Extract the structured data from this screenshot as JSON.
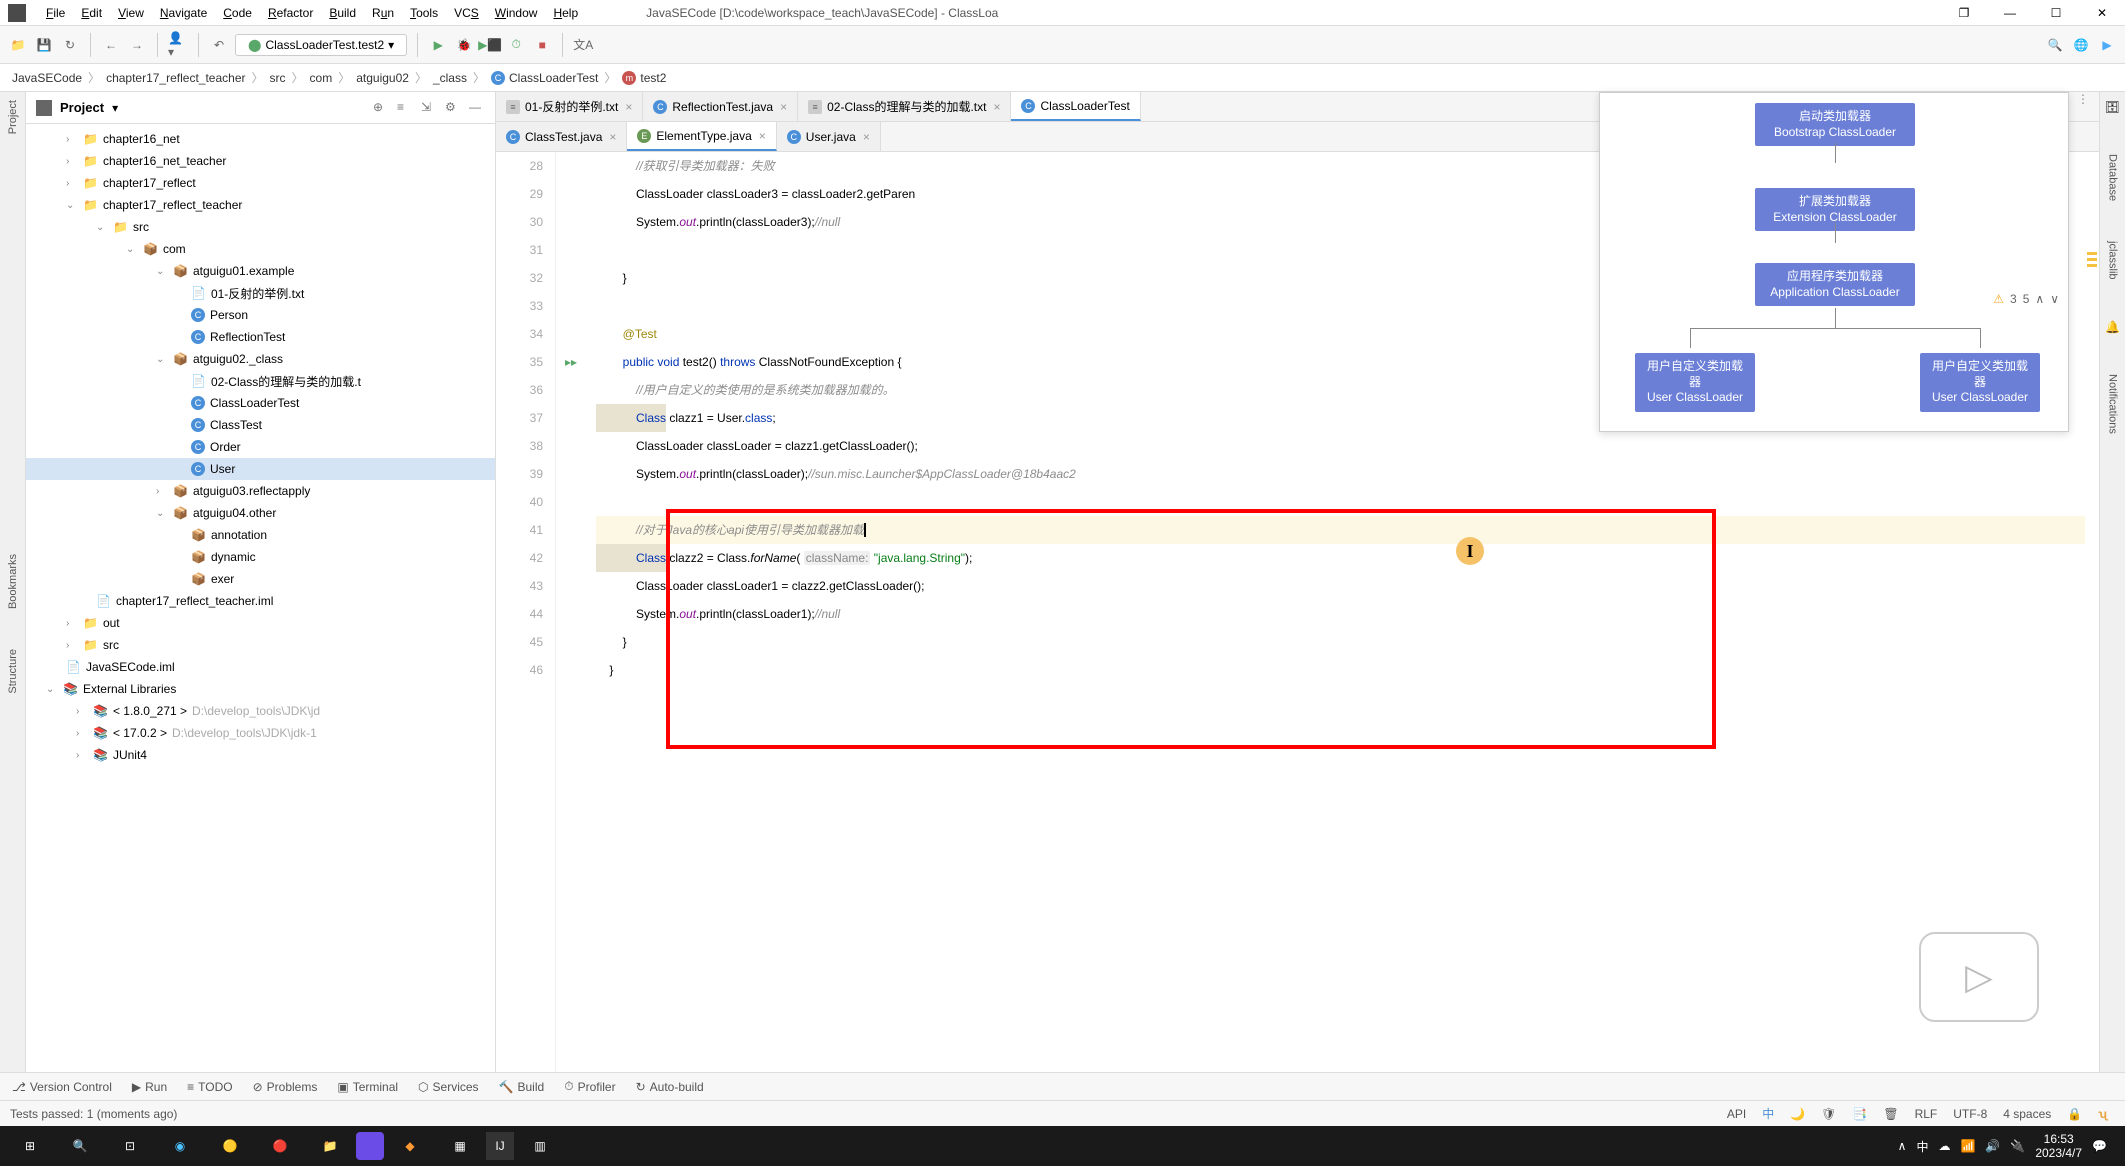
{
  "title": "JavaSECode [D:\\code\\workspace_teach\\JavaSECode] - ClassLoa",
  "menus": [
    "File",
    "Edit",
    "View",
    "Navigate",
    "Code",
    "Refactor",
    "Build",
    "Run",
    "Tools",
    "VCS",
    "Window",
    "Help"
  ],
  "run_config": "ClassLoaderTest.test2",
  "breadcrumb": [
    "JavaSECode",
    "chapter17_reflect_teacher",
    "src",
    "com",
    "atguigu02",
    "_class",
    "ClassLoaderTest",
    "test2"
  ],
  "project_label": "Project",
  "tree": {
    "chapter16_net": "chapter16_net",
    "chapter16_net_teacher": "chapter16_net_teacher",
    "chapter17_reflect": "chapter17_reflect",
    "chapter17_reflect_teacher": "chapter17_reflect_teacher",
    "src": "src",
    "com": "com",
    "pkg1": "atguigu01.example",
    "f1": "01-反射的举例.txt",
    "f2": "Person",
    "f3": "ReflectionTest",
    "pkg2": "atguigu02._class",
    "f4": "02-Class的理解与类的加载.t",
    "f5": "ClassLoaderTest",
    "f6": "ClassTest",
    "f7": "Order",
    "f8": "User",
    "pkg3": "atguigu03.reflectapply",
    "pkg4": "atguigu04.other",
    "f9": "annotation",
    "f10": "dynamic",
    "f11": "exer",
    "iml1": "chapter17_reflect_teacher.iml",
    "out": "out",
    "src2": "src",
    "iml2": "JavaSECode.iml",
    "ext": "External Libraries",
    "jdk1": "< 1.8.0_271 >",
    "jdk1p": "D:\\develop_tools\\JDK\\jd",
    "jdk2": "< 17.0.2 >",
    "jdk2p": "D:\\develop_tools\\JDK\\jdk-1",
    "junit": "JUnit4"
  },
  "tabs_top": [
    {
      "label": "01-反射的举例.txt",
      "type": "txt"
    },
    {
      "label": "ReflectionTest.java",
      "type": "c"
    },
    {
      "label": "02-Class的理解与类的加载.txt",
      "type": "txt"
    },
    {
      "label": "ClassLoaderTest",
      "type": "c",
      "active": true
    }
  ],
  "tabs_bottom": [
    {
      "label": "ClassTest.java",
      "type": "c"
    },
    {
      "label": "ElementType.java",
      "type": "e",
      "active": true
    },
    {
      "label": "User.java",
      "type": "c"
    }
  ],
  "code_lines": {
    "28": "            //获取引导类加载器：失败",
    "29": "            ClassLoader classLoader3 = classLoader2.getParen",
    "30a": "            System.",
    "30b": "out",
    "30c": ".println(classLoader3);",
    "30d": "//null",
    "32": "        }",
    "34": "        @Test",
    "35a": "        public void ",
    "35b": "test2",
    "35c": "() ",
    "35d": "throws",
    "35e": " ClassNotFoundException {",
    "36": "            //用户自定义的类使用的是系统类加载器加载的。",
    "37a": "            Class",
    "37b": " clazz1 = User.",
    "37c": "class",
    "37d": ";",
    "38": "            ClassLoader classLoader = clazz1.getClassLoader();",
    "39a": "            System.",
    "39b": "out",
    "39c": ".println(classLoader);",
    "39d": "//sun.misc.Launcher$AppClassLoader@18b4aac2",
    "41": "            //对于Java的核心api使用引导类加载器加载",
    "42a": "            Class",
    "42b": " clazz2 = Class.",
    "42c": "forName",
    "42d": "( ",
    "42e": "className:",
    "42f": " \"java.lang.String\"",
    "42g": ");",
    "43": "            ClassLoader classLoader1 = clazz2.getClassLoader();",
    "44a": "            System.",
    "44b": "out",
    "44c": ".println(classLoader1);",
    "44d": "//null",
    "45": "        }",
    "46": "    }"
  },
  "diagram": {
    "b1": "启动类加载器",
    "b1b": "Bootstrap ClassLoader",
    "b2": "扩展类加载器",
    "b2b": "Extension ClassLoader",
    "b3": "应用程序类加载器",
    "b3b": "Application ClassLoader",
    "b4": "用户自定义类加载器",
    "b4b": "User ClassLoader",
    "b5": "用户自定义类加载器",
    "b5b": "User ClassLoader"
  },
  "nav_info": {
    "warn": "3",
    "count": "5"
  },
  "bottom_tools": [
    "Version Control",
    "Run",
    "TODO",
    "Problems",
    "Terminal",
    "Services",
    "Build",
    "Profiler",
    "Auto-build"
  ],
  "status": {
    "tests": "Tests passed: 1 (moments ago)",
    "rlf": "RLF",
    "enc": "UTF-8",
    "indent": "4 spaces",
    "api": "API"
  },
  "taskbar": {
    "time": "16:53",
    "date": "2023/4/7"
  },
  "rails": {
    "proj": "Project",
    "struct": "Structure",
    "book": "Bookmarks",
    "db": "Database",
    "jcl": "jclasslib",
    "notif": "Notifications"
  }
}
